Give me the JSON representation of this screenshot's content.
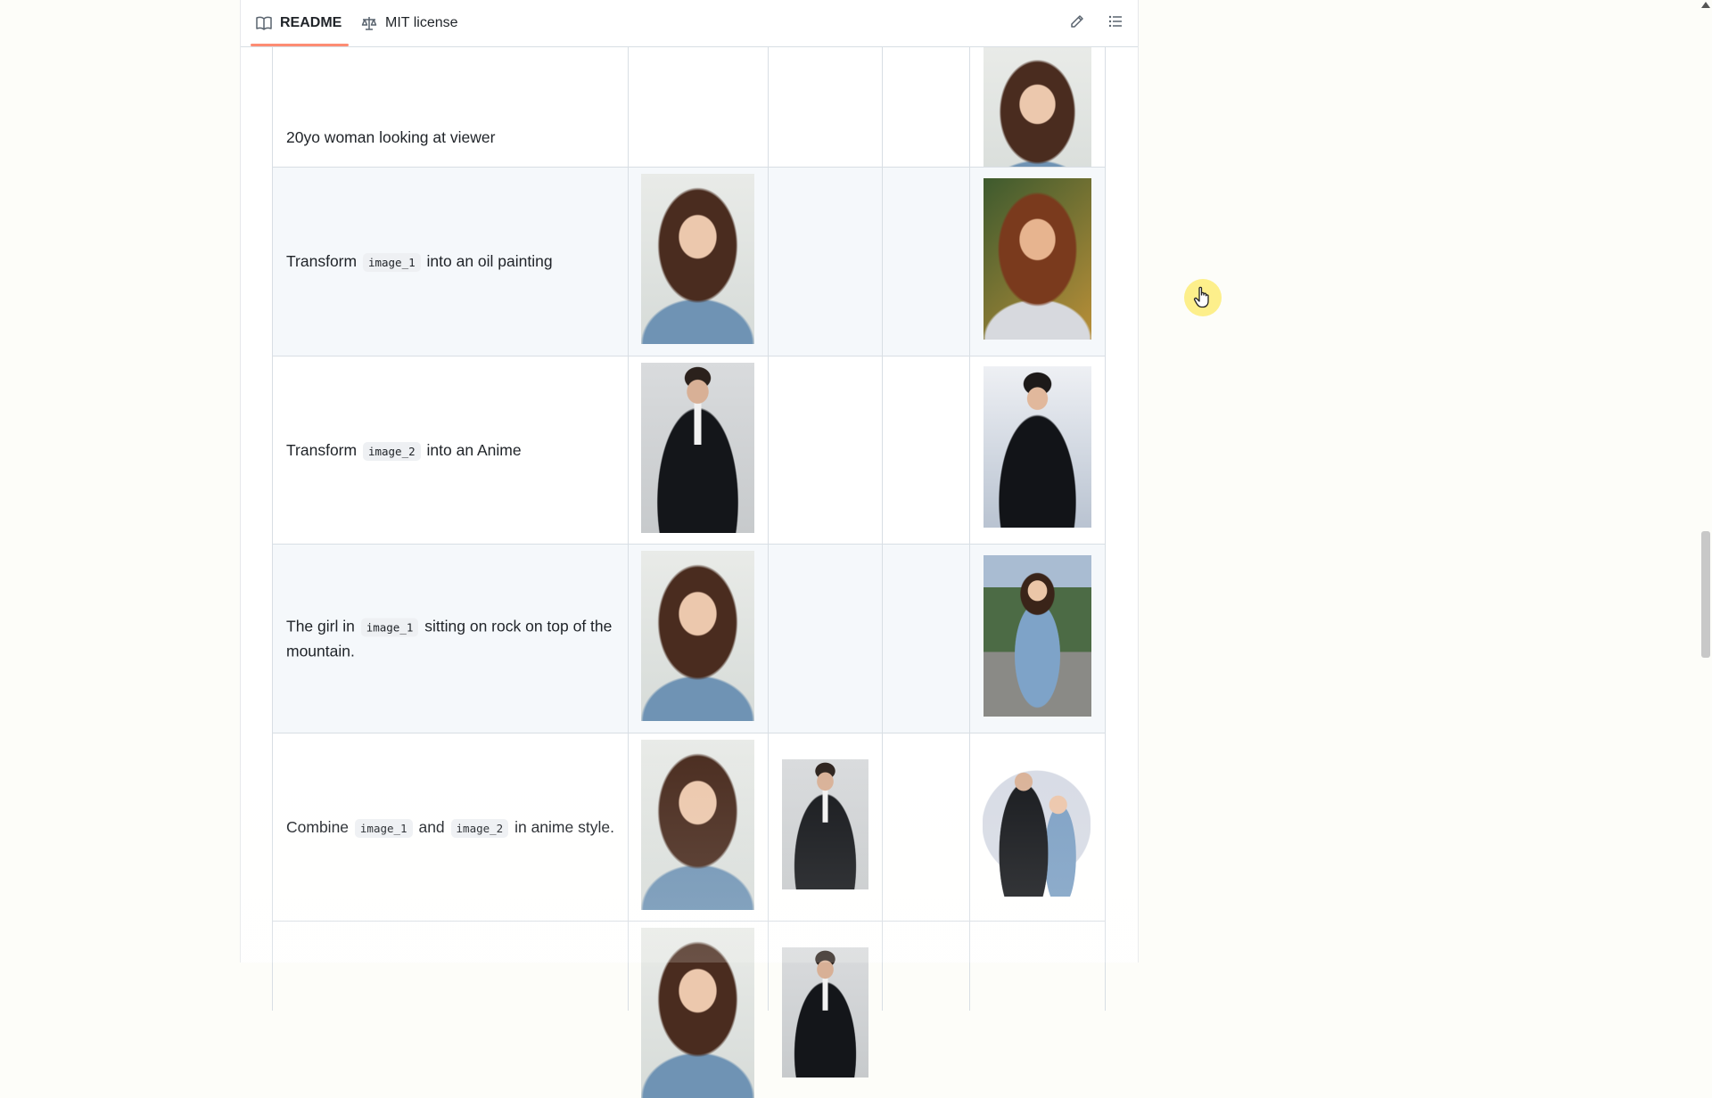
{
  "tabs": {
    "readme": {
      "label": "README",
      "icon": "book-icon"
    },
    "license": {
      "label": "MIT license",
      "icon": "scale-icon"
    },
    "actions": [
      {
        "icon": "pencil-icon"
      },
      {
        "icon": "list-icon"
      }
    ]
  },
  "table": {
    "rows": [
      {
        "prompt": [
          "20yo woman looking at viewer"
        ],
        "image_1": null,
        "image_2": null,
        "image_3": null,
        "output": "woman-portrait"
      },
      {
        "prompt": [
          "Transform ",
          {
            "code": "image_1"
          },
          " into an oil painting"
        ],
        "image_1": "woman-portrait",
        "image_2": null,
        "image_3": null,
        "output": "woman-oil-painting"
      },
      {
        "prompt": [
          "Transform ",
          {
            "code": "image_2"
          },
          " into an Anime"
        ],
        "image_1": "man-in-suit",
        "image_2": null,
        "image_3": null,
        "output": "man-anime"
      },
      {
        "prompt": [
          "The girl in ",
          {
            "code": "image_1"
          },
          " sitting on rock on top of the mountain."
        ],
        "image_1": "woman-portrait",
        "image_2": null,
        "image_3": null,
        "output": "woman-on-mountain"
      },
      {
        "prompt": [
          "Combine ",
          {
            "code": "image_1"
          },
          " and ",
          {
            "code": "image_2"
          },
          " in anime style."
        ],
        "image_1": "woman-portrait",
        "image_2": "man-in-suit",
        "image_3": null,
        "output": "couple-anime"
      },
      {
        "prompt": [],
        "image_1": "woman-portrait",
        "image_2": "man-in-suit",
        "image_3": null,
        "output": null
      }
    ]
  },
  "colors": {
    "tab_underline": "#fd8c73",
    "code_background": "#eef0f3",
    "cursor_highlight": "#fdec78",
    "row_alt_background": "#f5f8fb"
  },
  "cursor": {
    "icon": "hand-pointer-icon"
  }
}
